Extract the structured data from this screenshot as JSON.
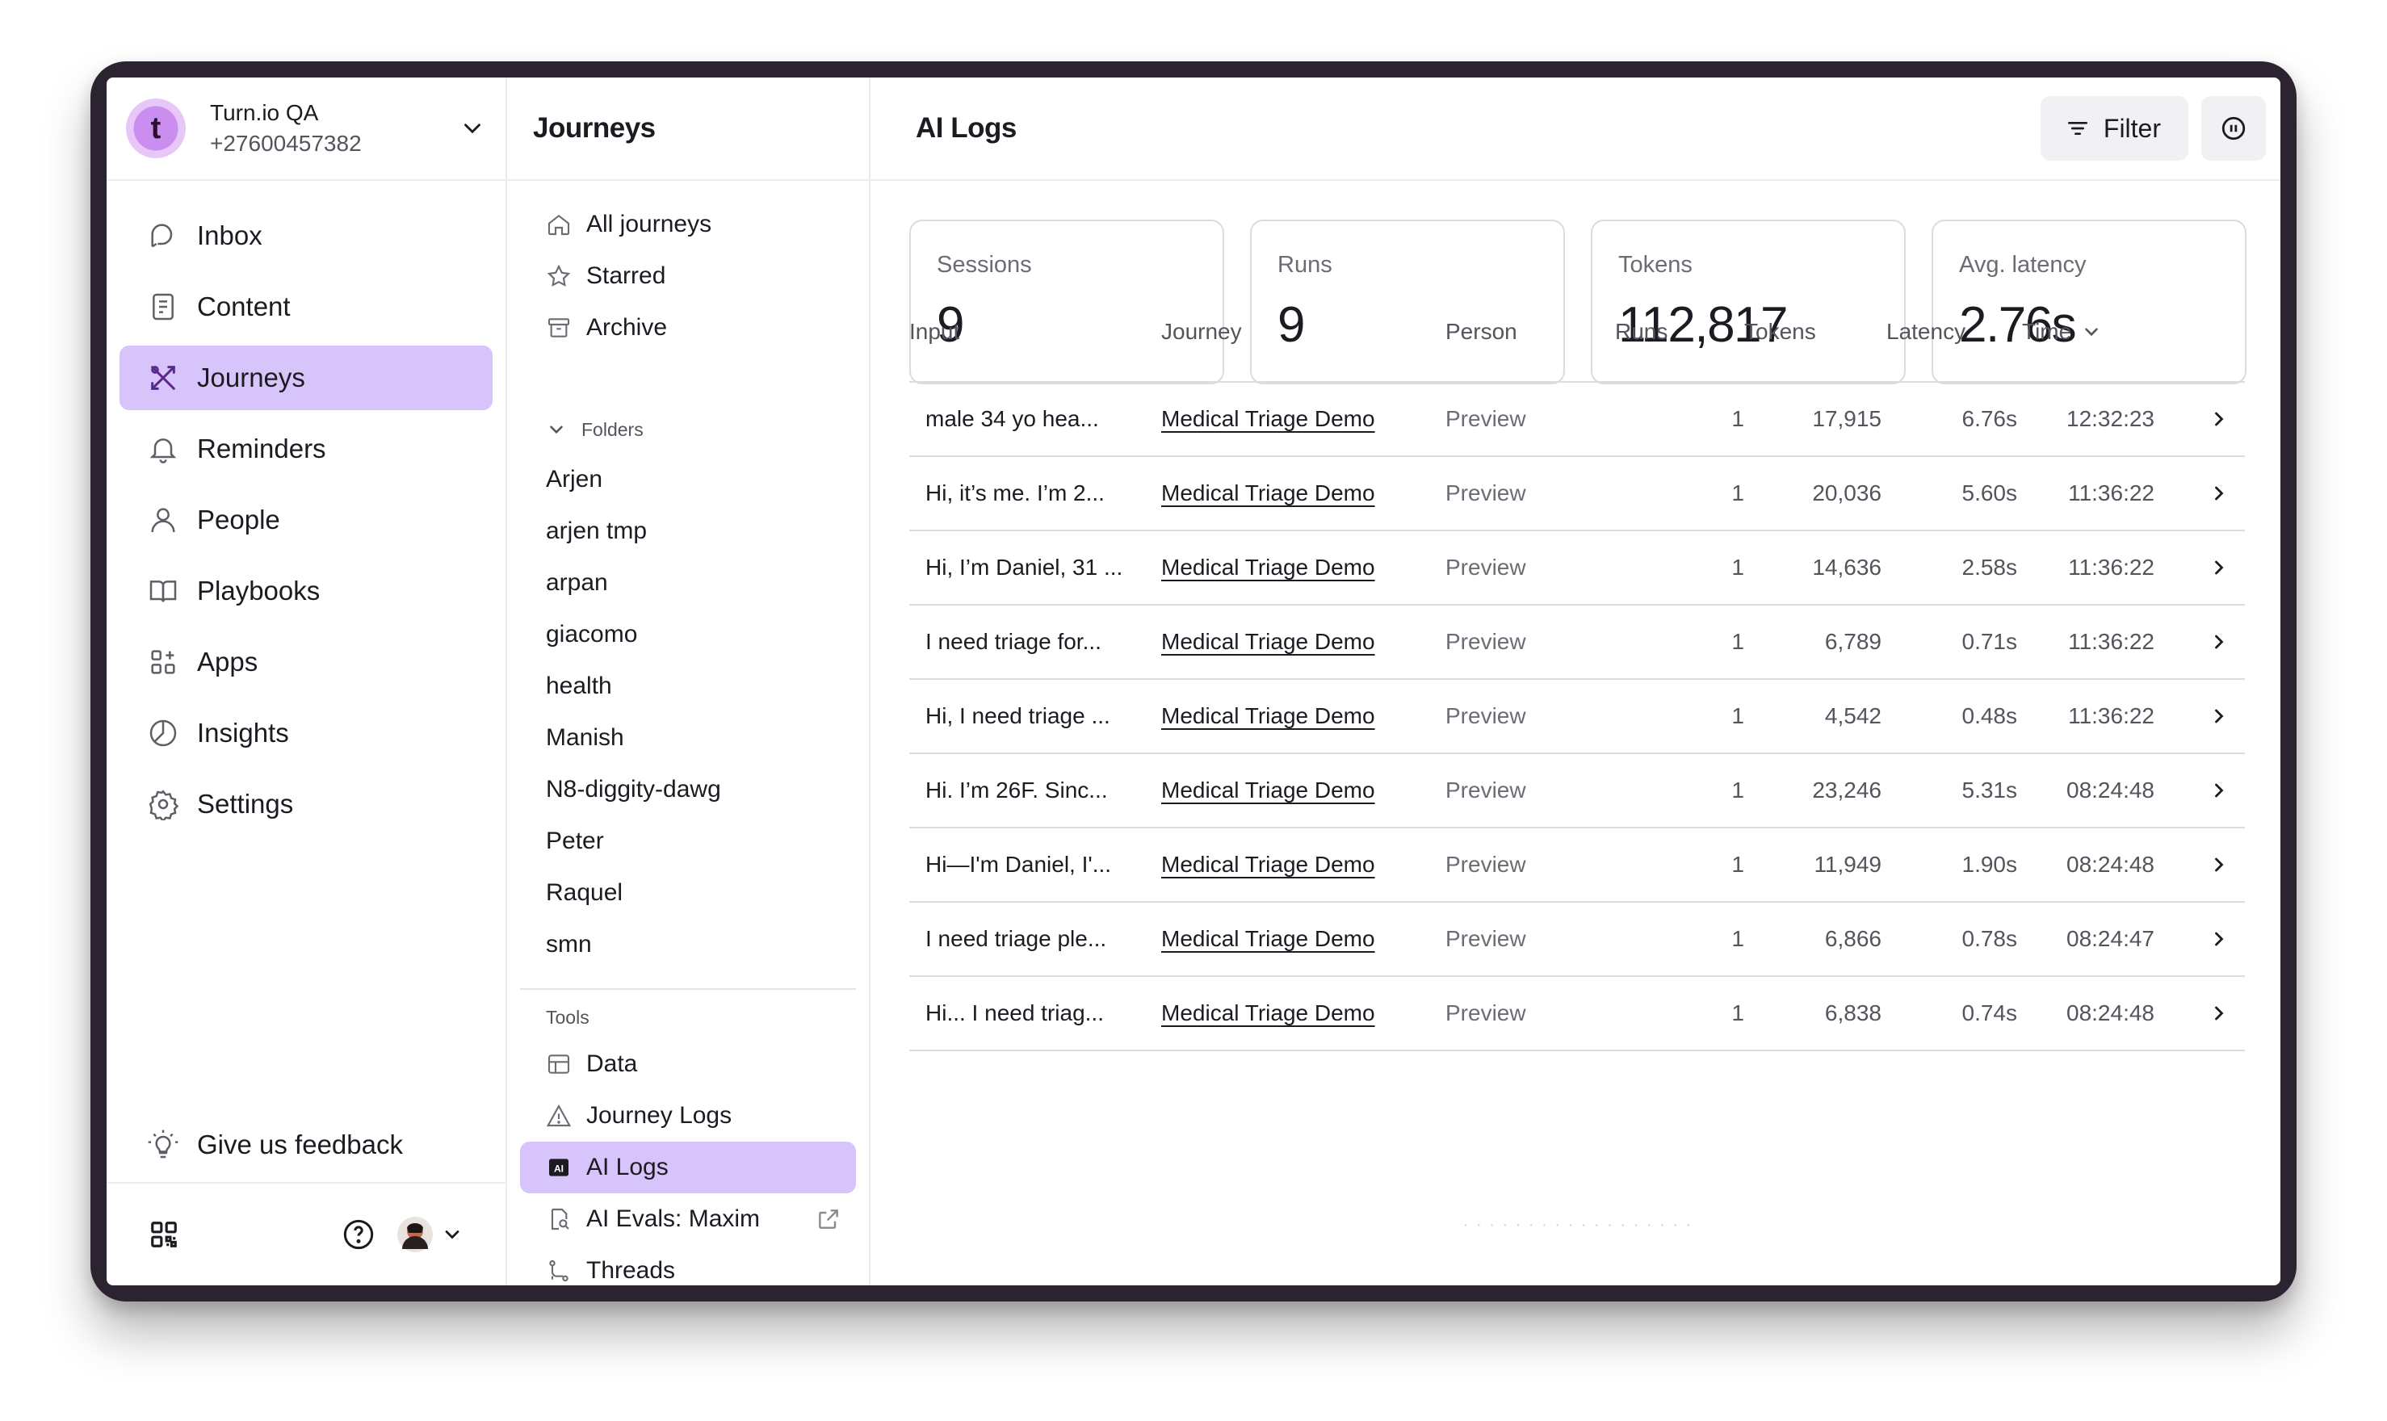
{
  "account": {
    "initial": "t",
    "name": "Turn.io QA",
    "phone": "+27600457382"
  },
  "nav": {
    "items": [
      {
        "label": "Inbox",
        "icon": "inbox-icon",
        "active": false
      },
      {
        "label": "Content",
        "icon": "content-icon",
        "active": false
      },
      {
        "label": "Journeys",
        "icon": "journeys-icon",
        "active": true
      },
      {
        "label": "Reminders",
        "icon": "bell-icon",
        "active": false
      },
      {
        "label": "People",
        "icon": "person-icon",
        "active": false
      },
      {
        "label": "Playbooks",
        "icon": "book-icon",
        "active": false
      },
      {
        "label": "Apps",
        "icon": "apps-icon",
        "active": false
      },
      {
        "label": "Insights",
        "icon": "chart-icon",
        "active": false
      },
      {
        "label": "Settings",
        "icon": "gear-icon",
        "active": false
      }
    ],
    "feedback": "Give us feedback"
  },
  "journeys": {
    "title": "Journeys",
    "items": [
      {
        "label": "All journeys",
        "icon": "home-icon"
      },
      {
        "label": "Starred",
        "icon": "star-icon"
      },
      {
        "label": "Archive",
        "icon": "archive-icon"
      }
    ],
    "folders_label": "Folders",
    "folders": [
      "Arjen",
      "arjen tmp",
      "arpan",
      "giacomo",
      "health",
      "Manish",
      "N8-diggity-dawg",
      "Peter",
      "Raquel",
      "smn"
    ],
    "tools_label": "Tools",
    "tools": [
      {
        "label": "Data",
        "icon": "table-icon",
        "active": false
      },
      {
        "label": "Journey Logs",
        "icon": "warning-icon",
        "active": false
      },
      {
        "label": "AI Logs",
        "icon": "ai-icon",
        "active": true
      },
      {
        "label": "AI Evals: Maxim",
        "icon": "eval-icon",
        "active": false
      },
      {
        "label": "Threads",
        "icon": "threads-icon",
        "active": false
      }
    ]
  },
  "main": {
    "title": "AI Logs",
    "filter_label": "Filter",
    "stats": [
      {
        "label": "Sessions",
        "value": "9"
      },
      {
        "label": "Runs",
        "value": "9"
      },
      {
        "label": "Tokens",
        "value": "112,817"
      },
      {
        "label": "Avg. latency",
        "value": "2.76s"
      }
    ],
    "columns": {
      "input": "Input",
      "journey": "Journey",
      "person": "Person",
      "runs": "Runs",
      "tokens": "Tokens",
      "latency": "Latency",
      "time": "Time"
    },
    "rows": [
      {
        "input": "male 34 yo hea...",
        "journey": "Medical Triage Demo",
        "person": "Preview",
        "runs": "1",
        "tokens": "17,915",
        "latency": "6.76s",
        "time": "12:32:23"
      },
      {
        "input": "Hi, it’s me. I’m 2...",
        "journey": "Medical Triage Demo",
        "person": "Preview",
        "runs": "1",
        "tokens": "20,036",
        "latency": "5.60s",
        "time": "11:36:22"
      },
      {
        "input": "Hi, I’m Daniel, 31 ...",
        "journey": "Medical Triage Demo",
        "person": "Preview",
        "runs": "1",
        "tokens": "14,636",
        "latency": "2.58s",
        "time": "11:36:22"
      },
      {
        "input": "I need triage for...",
        "journey": "Medical Triage Demo",
        "person": "Preview",
        "runs": "1",
        "tokens": "6,789",
        "latency": "0.71s",
        "time": "11:36:22"
      },
      {
        "input": "Hi, I need triage ...",
        "journey": "Medical Triage Demo",
        "person": "Preview",
        "runs": "1",
        "tokens": "4,542",
        "latency": "0.48s",
        "time": "11:36:22"
      },
      {
        "input": "Hi. I’m 26F. Sinc...",
        "journey": "Medical Triage Demo",
        "person": "Preview",
        "runs": "1",
        "tokens": "23,246",
        "latency": "5.31s",
        "time": "08:24:48"
      },
      {
        "input": "Hi—I'm Daniel, I'...",
        "journey": "Medical Triage Demo",
        "person": "Preview",
        "runs": "1",
        "tokens": "11,949",
        "latency": "1.90s",
        "time": "08:24:48"
      },
      {
        "input": "I need triage ple...",
        "journey": "Medical Triage Demo",
        "person": "Preview",
        "runs": "1",
        "tokens": "6,866",
        "latency": "0.78s",
        "time": "08:24:47"
      },
      {
        "input": "Hi... I need triag...",
        "journey": "Medical Triage Demo",
        "person": "Preview",
        "runs": "1",
        "tokens": "6,838",
        "latency": "0.74s",
        "time": "08:24:48"
      }
    ]
  },
  "colors": {
    "accent": "#d6c4fb",
    "accent_icon": "#5a2a8a",
    "frame": "#2b2330"
  }
}
